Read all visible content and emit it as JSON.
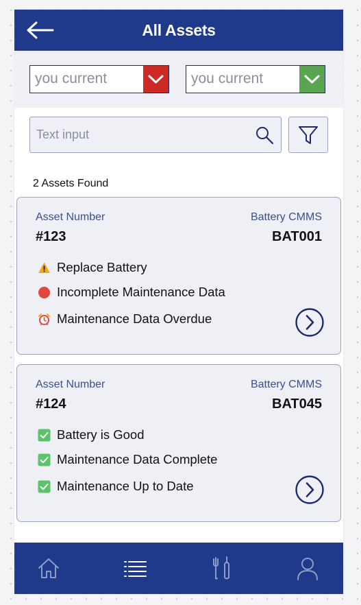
{
  "header": {
    "title": "All Assets"
  },
  "filters": {
    "dropdown_1": {
      "value": "you current",
      "chevron_color": "#cc2a24"
    },
    "dropdown_2": {
      "value": "you current",
      "chevron_color": "#5aa552"
    }
  },
  "search": {
    "placeholder": "Text input"
  },
  "results": {
    "count_label": "2 Assets Found"
  },
  "assets": [
    {
      "asset_label": "Asset Number",
      "asset_number": "#123",
      "cmms_label": "Battery CMMS",
      "cmms_value": "BAT001",
      "statuses": [
        {
          "icon": "warning-icon",
          "text": "Replace Battery"
        },
        {
          "icon": "red-circle-icon",
          "text": "Incomplete Maintenance Data"
        },
        {
          "icon": "alarm-clock-icon",
          "text": "Maintenance Data Overdue"
        }
      ]
    },
    {
      "asset_label": "Asset Number",
      "asset_number": "#124",
      "cmms_label": "Battery CMMS",
      "cmms_value": "BAT045",
      "statuses": [
        {
          "icon": "check-box-icon",
          "text": "Battery is Good"
        },
        {
          "icon": "check-box-icon",
          "text": "Maintenance Data Complete"
        },
        {
          "icon": "check-box-icon",
          "text": "Maintenance Up to Date"
        }
      ]
    }
  ],
  "nav": {
    "items": [
      {
        "icon": "home-icon"
      },
      {
        "icon": "list-icon"
      },
      {
        "icon": "tools-icon"
      },
      {
        "icon": "profile-icon"
      }
    ]
  },
  "colors": {
    "primary": "#1f3a8a",
    "card_background": "#eef0f6",
    "label_blue": "#3b4f8e",
    "error_red": "#e0473d",
    "success_green": "#5cc36a",
    "warning_amber": "#f0a81c"
  }
}
